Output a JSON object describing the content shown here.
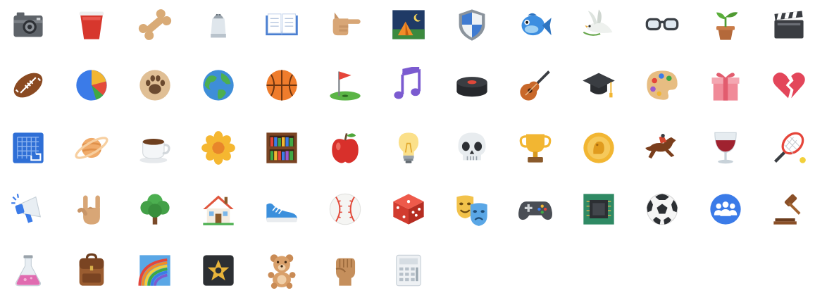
{
  "title": "",
  "icons": [
    "camera-icon",
    "red-cup-icon",
    "bone-icon",
    "salt-shaker-icon",
    "open-book-icon",
    "pointing-hand-icon",
    "night-camping-icon",
    "shield-icon",
    "fish-icon",
    "dove-icon",
    "glasses-icon",
    "seedling-icon",
    "clapper-board-icon",
    "american-football-icon",
    "pie-chart-icon",
    "paw-print-icon",
    "globe-icon",
    "basketball-icon",
    "golf-flag-icon",
    "music-note-icon",
    "hockey-puck-icon",
    "guitar-icon",
    "graduation-cap-icon",
    "artist-palette-icon",
    "gift-icon",
    "broken-heart-icon",
    "blue-grid-icon",
    "ringed-planet-icon",
    "coffee-cup-icon",
    "sunflower-icon",
    "bookshelf-icon",
    "red-apple-icon",
    "light-bulb-icon",
    "skull-icon",
    "trophy-icon",
    "gold-coin-icon",
    "racehorse-icon",
    "wine-glass-icon",
    "tennis-racket-icon",
    "megaphone-icon",
    "rock-hand-icon",
    "tree-icon",
    "house-icon",
    "sneaker-icon",
    "baseball-icon",
    "dice-icon",
    "theater-masks-icon",
    "game-controller-icon",
    "microchip-icon",
    "soccer-ball-icon",
    "group-icon",
    "gavel-icon",
    "flask-icon",
    "backpack-icon",
    "rainbow-icon",
    "star-badge-icon",
    "teddy-bear-icon",
    "raised-fist-icon",
    "calculator-icon"
  ],
  "colors": {
    "background": "#ffffff",
    "skin": "#d9a878",
    "blue": "#3b7be8",
    "red": "#e03a2f",
    "green": "#3fa845",
    "gold": "#f2b632",
    "gray": "#6a6f76",
    "dark": "#33363b"
  }
}
